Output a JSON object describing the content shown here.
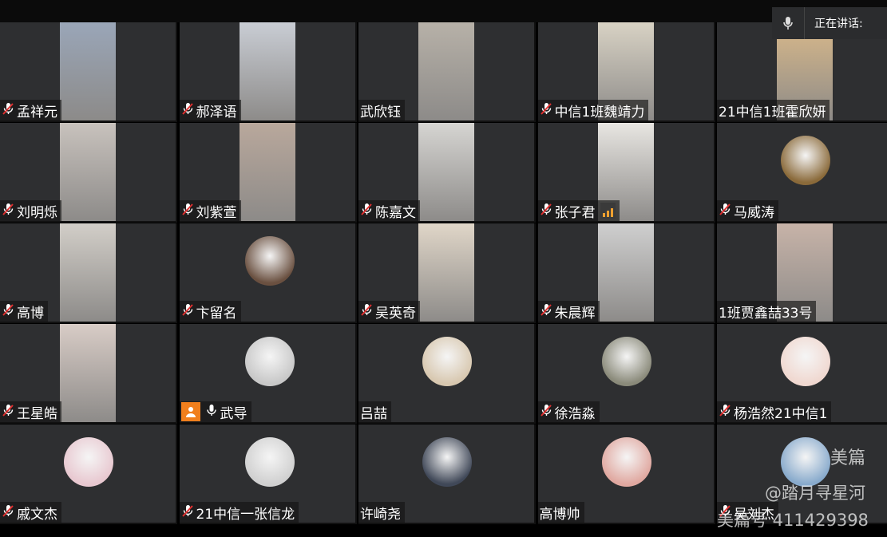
{
  "speaking": {
    "label": "正在讲话:"
  },
  "participants": [
    {
      "name": "孟祥元",
      "muted": true,
      "kind": "video",
      "bg": "#9aa6b8"
    },
    {
      "name": "郝泽语",
      "muted": true,
      "kind": "video",
      "bg": "#c9cdd4"
    },
    {
      "name": "武欣钰",
      "muted": false,
      "kind": "video",
      "bg": "#b7b1a8"
    },
    {
      "name": "中信1班魏靖力",
      "muted": true,
      "kind": "video",
      "bg": "#d8d2c4"
    },
    {
      "name": "21中信1班霍欣妍",
      "muted": false,
      "kind": "video",
      "bg": "#d9b98a"
    },
    {
      "name": "刘明烁",
      "muted": true,
      "kind": "video",
      "bg": "#c8c2bd"
    },
    {
      "name": "刘紫萱",
      "muted": true,
      "kind": "video",
      "bg": "#b9a89c"
    },
    {
      "name": "陈嘉文",
      "muted": true,
      "kind": "video",
      "bg": "#d6d5d2"
    },
    {
      "name": "张子君",
      "muted": true,
      "kind": "video",
      "bg": "#e8e6e2",
      "signal": true
    },
    {
      "name": "马威涛",
      "muted": true,
      "kind": "avatar",
      "bg": "#8a6a3a"
    },
    {
      "name": "高博",
      "muted": true,
      "kind": "video",
      "bg": "#d2cec8"
    },
    {
      "name": "卞留名",
      "muted": true,
      "kind": "avatar",
      "bg": "#6a5040"
    },
    {
      "name": "吴英奇",
      "muted": true,
      "kind": "video",
      "bg": "#e0d6c8"
    },
    {
      "name": "朱晨辉",
      "muted": true,
      "kind": "video",
      "bg": "#cfcfcf"
    },
    {
      "name": "1班贾鑫喆33号",
      "muted": false,
      "kind": "video",
      "bg": "#c7b3a8"
    },
    {
      "name": "王星皓",
      "muted": true,
      "kind": "video",
      "bg": "#d8ccc6"
    },
    {
      "name": "武导",
      "muted": false,
      "kind": "avatar",
      "bg": "#c8c8c8",
      "userBadge": true,
      "micOn": true
    },
    {
      "name": "吕喆",
      "muted": false,
      "kind": "avatar",
      "bg": "#d8c8b0"
    },
    {
      "name": "徐浩淼",
      "muted": true,
      "kind": "avatar",
      "bg": "#8a8a7a"
    },
    {
      "name": "杨浩然21中信1",
      "muted": true,
      "kind": "avatar",
      "bg": "#f0d8d0"
    },
    {
      "name": "戚文杰",
      "muted": true,
      "kind": "avatar",
      "bg": "#e8c8d0"
    },
    {
      "name": "21中信一张信龙",
      "muted": true,
      "kind": "avatar",
      "bg": "#d0d0d0"
    },
    {
      "name": "许崎尧",
      "muted": false,
      "kind": "avatar",
      "bg": "#404858"
    },
    {
      "name": "高博帅",
      "muted": false,
      "kind": "avatar",
      "bg": "#e0a8a0"
    },
    {
      "name": "吴刘杰",
      "muted": true,
      "kind": "avatar",
      "bg": "#88aacc"
    }
  ],
  "watermark": {
    "brand": "美篇",
    "handle": "@踏月寻星河",
    "id_line": "美篇号 411429398"
  }
}
